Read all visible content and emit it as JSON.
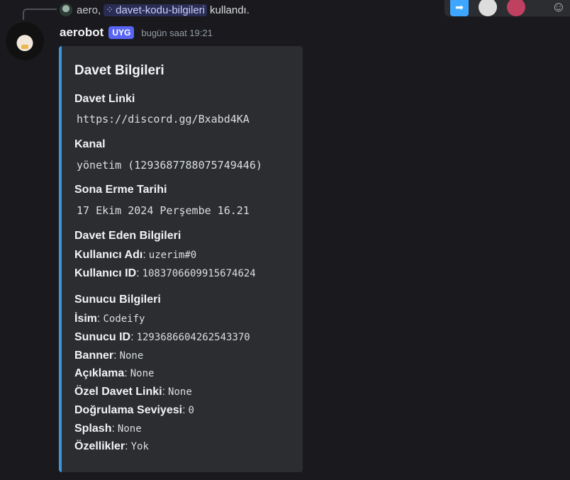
{
  "reply": {
    "username": "aero,",
    "command": "davet-kodu-bilgileri",
    "suffix": "kullandı."
  },
  "message": {
    "author": "aerobot",
    "tag": "UYG",
    "timestamp": "bugün saat 19:21"
  },
  "embed": {
    "title": "Davet Bilgileri",
    "fields": [
      {
        "name": "Davet Linki",
        "value": "https://discord.gg/Bxabd4KA"
      },
      {
        "name": "Kanal",
        "value": "yönetim (1293687788075749446)"
      },
      {
        "name": "Sona Erme Tarihi",
        "value": "17 Ekim 2024 Perşembe 16.21"
      }
    ],
    "inviter": {
      "heading": "Davet Eden Bilgileri",
      "rows": [
        {
          "key": "Kullanıcı Adı",
          "value": "uzerim#0"
        },
        {
          "key": "Kullanıcı ID",
          "value": "1083706609915674624"
        }
      ]
    },
    "server": {
      "heading": "Sunucu Bilgileri",
      "rows": [
        {
          "key": "İsim",
          "value": "Codeify"
        },
        {
          "key": "Sunucu ID",
          "value": "1293686604262543370"
        },
        {
          "key": "Banner",
          "value": "None"
        },
        {
          "key": "Açıklama",
          "value": "None"
        },
        {
          "key": "Özel Davet Linki",
          "value": "None"
        },
        {
          "key": "Doğrulama Seviyesi",
          "value": "0"
        },
        {
          "key": "Splash",
          "value": "None"
        },
        {
          "key": "Özellikler",
          "value": "Yok"
        }
      ]
    }
  },
  "icons": {
    "command": "⁘",
    "forward": "➡",
    "react": "☺"
  },
  "colors": {
    "embed_accent": "#3a96dd",
    "app_tag": "#5865f2"
  }
}
